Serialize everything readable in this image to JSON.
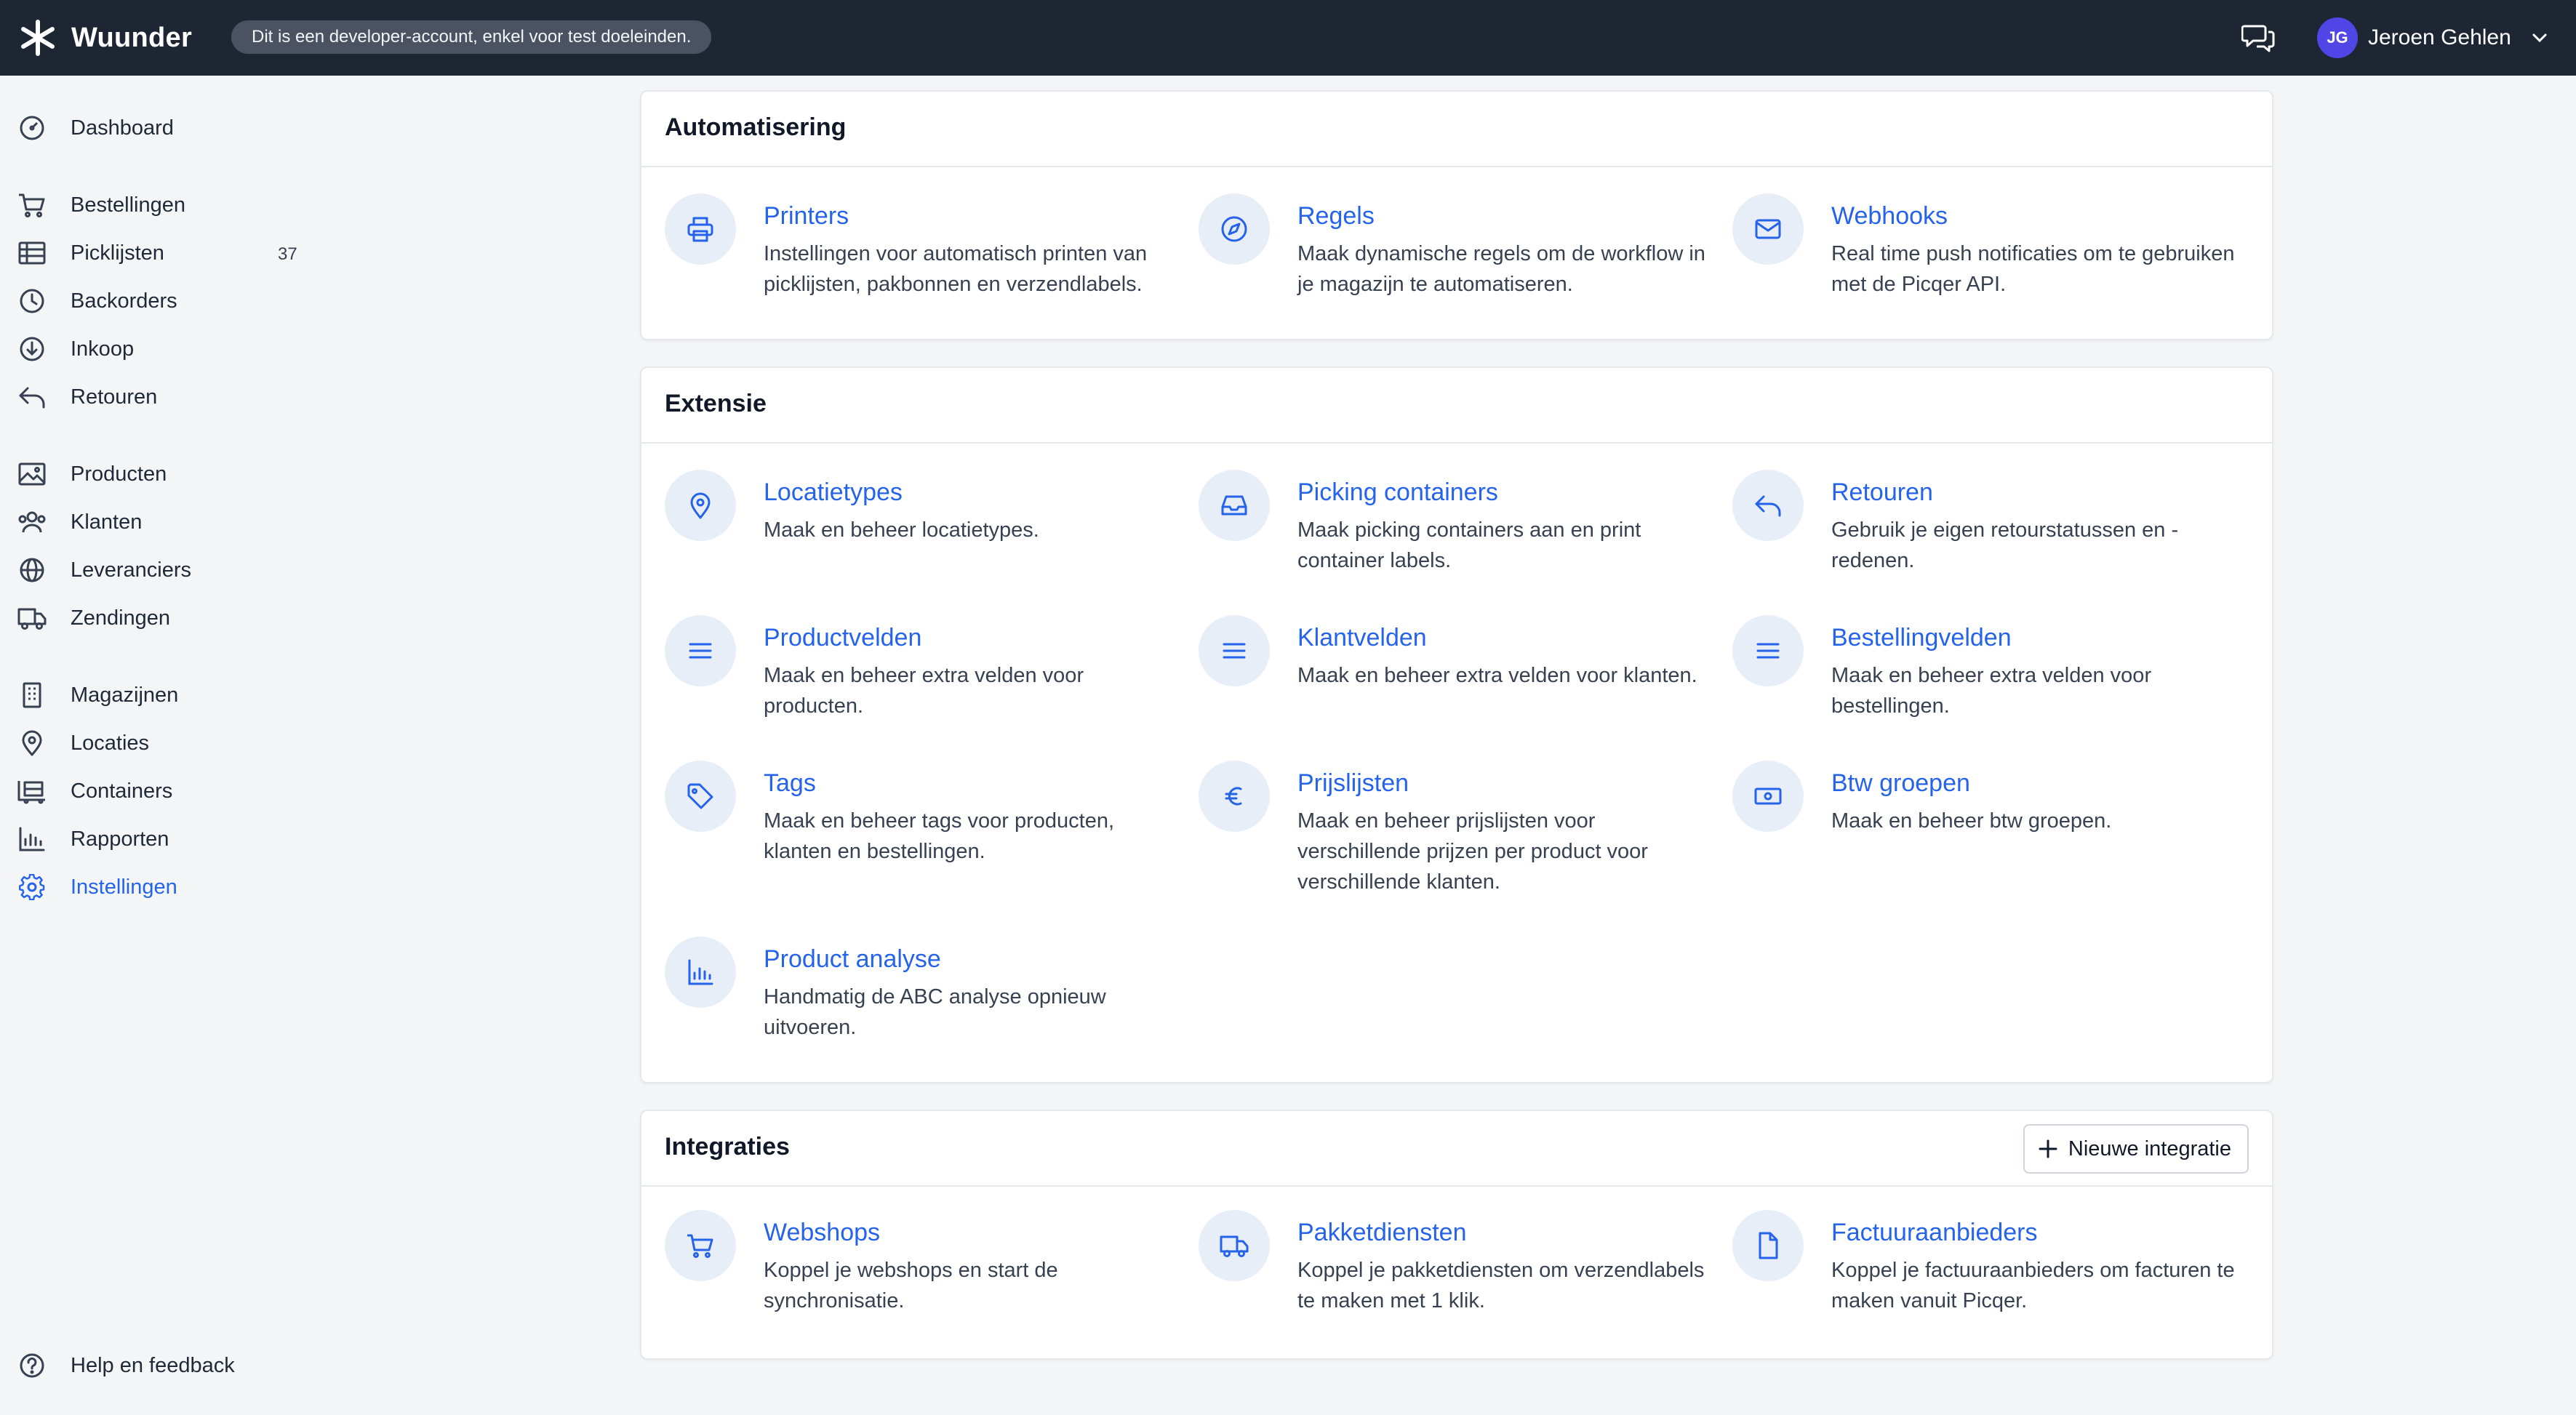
{
  "topbar": {
    "brand": "Wuunder",
    "dev_notice": "Dit is een developer-account, enkel voor test doeleinden.",
    "user_initials": "JG",
    "user_name": "Jeroen Gehlen",
    "avatar_color": "#4f46e5"
  },
  "sidebar": {
    "items": [
      {
        "label": "Dashboard",
        "icon": "dashboard-icon"
      },
      {
        "label": "Bestellingen",
        "icon": "cart-icon"
      },
      {
        "label": "Picklijsten",
        "icon": "table-icon",
        "badge": "37"
      },
      {
        "label": "Backorders",
        "icon": "clock-icon"
      },
      {
        "label": "Inkoop",
        "icon": "download-icon"
      },
      {
        "label": "Retouren",
        "icon": "return-icon"
      },
      {
        "label": "Producten",
        "icon": "image-icon"
      },
      {
        "label": "Klanten",
        "icon": "users-icon"
      },
      {
        "label": "Leveranciers",
        "icon": "globe-icon"
      },
      {
        "label": "Zendingen",
        "icon": "truck-icon"
      },
      {
        "label": "Magazijnen",
        "icon": "building-icon"
      },
      {
        "label": "Locaties",
        "icon": "map-pin-icon"
      },
      {
        "label": "Containers",
        "icon": "containers-icon"
      },
      {
        "label": "Rapporten",
        "icon": "chart-icon"
      },
      {
        "label": "Instellingen",
        "icon": "gear-icon",
        "active": true
      }
    ],
    "help": "Help en feedback"
  },
  "sections": {
    "automatisering": {
      "title": "Automatisering",
      "items": [
        {
          "title": "Printers",
          "desc": "Instellingen voor automatisch printen van picklijsten, pakbonnen en verzendlabels.",
          "icon": "printer-icon"
        },
        {
          "title": "Regels",
          "desc": "Maak dynamische regels om de workflow in je magazijn te automatiseren.",
          "icon": "compass-icon"
        },
        {
          "title": "Webhooks",
          "desc": "Real time push notificaties om te gebruiken met de Picqer API.",
          "icon": "mail-icon"
        }
      ]
    },
    "extensie": {
      "title": "Extensie",
      "items": [
        {
          "title": "Locatietypes",
          "desc": "Maak en beheer locatietypes.",
          "icon": "map-pin-icon"
        },
        {
          "title": "Picking containers",
          "desc": "Maak picking containers aan en print container labels.",
          "icon": "inbox-icon"
        },
        {
          "title": "Retouren",
          "desc": "Gebruik je eigen retourstatussen en -redenen.",
          "icon": "return-icon"
        },
        {
          "title": "Productvelden",
          "desc": "Maak en beheer extra velden voor producten.",
          "icon": "lines-icon"
        },
        {
          "title": "Klantvelden",
          "desc": "Maak en beheer extra velden voor klanten.",
          "icon": "lines-icon"
        },
        {
          "title": "Bestellingvelden",
          "desc": "Maak en beheer extra velden voor bestellingen.",
          "icon": "lines-icon"
        },
        {
          "title": "Tags",
          "desc": "Maak en beheer tags voor producten, klanten en bestellingen.",
          "icon": "tag-icon"
        },
        {
          "title": "Prijslijsten",
          "desc": "Maak en beheer prijslijsten voor verschillende prijzen per product voor verschillende klanten.",
          "icon": "euro-icon"
        },
        {
          "title": "Btw groepen",
          "desc": "Maak en beheer btw groepen.",
          "icon": "cash-icon"
        },
        {
          "title": "Product analyse",
          "desc": "Handmatig de ABC analyse opnieuw uitvoeren.",
          "icon": "chart-icon"
        }
      ]
    },
    "integraties": {
      "title": "Integraties",
      "new_button": "Nieuwe integratie",
      "items": [
        {
          "title": "Webshops",
          "desc": "Koppel je webshops en start de synchronisatie.",
          "icon": "cart-icon"
        },
        {
          "title": "Pakketdiensten",
          "desc": "Koppel je pakketdiensten om verzendlabels te maken met 1 klik.",
          "icon": "truck-icon"
        },
        {
          "title": "Factuuraanbieders",
          "desc": "Koppel je factuuraanbieders om facturen te maken vanuit Picqer.",
          "icon": "document-icon"
        }
      ]
    }
  },
  "colors": {
    "accent": "#2563eb",
    "topbar": "#1e2533",
    "icon_circle": "#e8eef8"
  }
}
